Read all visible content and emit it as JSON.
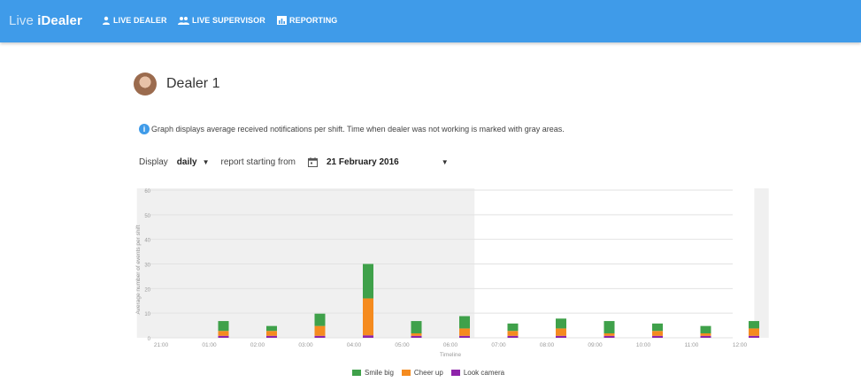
{
  "header": {
    "brand_prefix": "Live ",
    "brand_name": "iDealer",
    "nav": [
      {
        "label": "LIVE DEALER",
        "icon": "person-icon"
      },
      {
        "label": "LIVE SUPERVISOR",
        "icon": "people-icon"
      },
      {
        "label": "REPORTING",
        "icon": "report-chart-icon"
      }
    ],
    "bar_color": "#3f9be9"
  },
  "dealer": {
    "name": "Dealer 1"
  },
  "info_text": "Graph displays average received notifications per shift. Time when dealer was not working is marked with gray areas.",
  "controls": {
    "display_label": "Display",
    "display_value": "daily",
    "report_label": "report starting from",
    "date_value": "21 February 2016"
  },
  "chart_data": {
    "type": "bar",
    "stacked": true,
    "xlabel": "Timeline",
    "ylabel": "Average number of events per shift",
    "ylim": [
      0,
      60
    ],
    "yticks": [
      0,
      10,
      20,
      30,
      40,
      50,
      60
    ],
    "x_ticks": [
      "21:00",
      "01:00",
      "02:00",
      "03:00",
      "04:00",
      "05:00",
      "06:00",
      "07:00",
      "08:00",
      "09:00",
      "10:00",
      "11:00",
      "12:00"
    ],
    "grid": true,
    "legend_position": "bottom-center",
    "series": [
      {
        "name": "Smile big",
        "color": "#3fa14a",
        "values": [
          4,
          2,
          5,
          14,
          5,
          5,
          3,
          4,
          5,
          3,
          3,
          3
        ]
      },
      {
        "name": "Cheer up",
        "color": "#f58b1f",
        "values": [
          2,
          2,
          4,
          15,
          1,
          3,
          2,
          3,
          1,
          2,
          1,
          3
        ]
      },
      {
        "name": "Look camera",
        "color": "#8e24aa",
        "values": [
          0.8,
          0.8,
          0.8,
          1,
          0.8,
          0.8,
          0.8,
          0.8,
          0.8,
          0.8,
          0.8,
          0.8
        ]
      }
    ],
    "gray_areas": [
      [
        -0.5,
        6.5
      ],
      [
        12.3,
        12.6
      ]
    ]
  }
}
